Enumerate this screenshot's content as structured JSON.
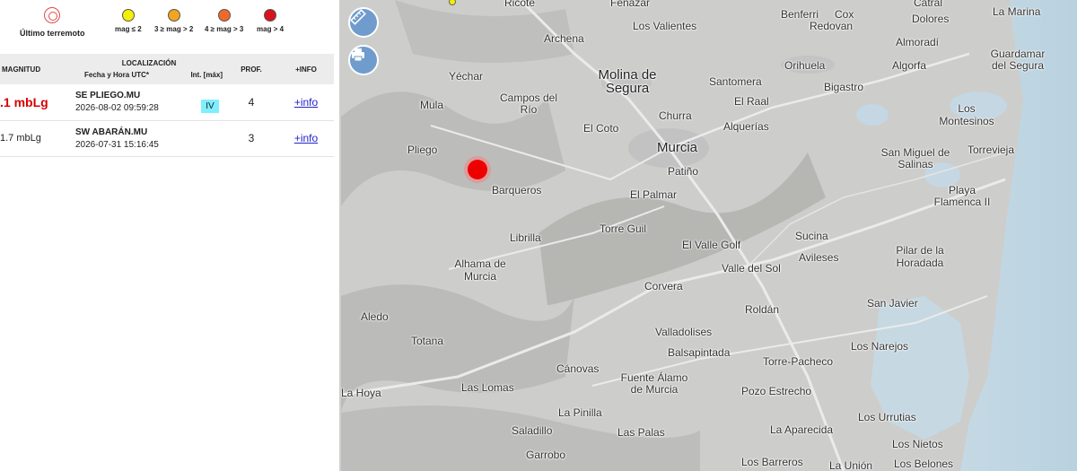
{
  "legend": {
    "last_quake_label": "Último terremoto",
    "items": [
      {
        "label": "mag ≤ 2",
        "color": "#f5f000"
      },
      {
        "label": "3 ≥ mag > 2",
        "color": "#f3a520"
      },
      {
        "label": "4 ≥ mag > 3",
        "color": "#ef6a2a"
      },
      {
        "label": "mag > 4",
        "color": "#d7141c"
      }
    ]
  },
  "table": {
    "headers": {
      "magnitude": "MAGNITUD",
      "location": "LOCALIZACIÓN",
      "datetime": "Fecha y Hora UTC*",
      "intensity": "Int. [máx]",
      "depth": "PROF.",
      "info": "+INFO"
    },
    "rows": [
      {
        "magnitude": ".1 mbLg",
        "place": "SE PLIEGO.MU",
        "datetime": "2026-08-02 09:59:28",
        "intensity": "IV",
        "depth": "4",
        "info": "+info"
      },
      {
        "magnitude": "1.7 mbLg",
        "place": "SW ABARÁN.MU",
        "datetime": "2026-07-31 15:16:45",
        "intensity": "",
        "depth": "3",
        "info": "+info"
      }
    ]
  },
  "map": {
    "tools": {
      "ruler_icon": "ruler-icon",
      "print_icon": "printer-icon"
    },
    "places": [
      "Ricote",
      "Fenazar",
      "Benferri",
      "Cox",
      "Catral",
      "La Marina",
      "Dolores",
      "Los Valientes",
      "Redovan",
      "Archena",
      "Almoradí",
      "Guardamar del Segura",
      "Yéchar",
      "Molina de Segura",
      "Orihuela",
      "Algorfa",
      "Santomera",
      "Bigastro",
      "Campos del Río",
      "Mula",
      "El Raal",
      "Los Montesinos",
      "Churra",
      "El Coto",
      "Alquerías",
      "Murcia",
      "San Miguel de Salinas",
      "Torrevieja",
      "Pliego",
      "Patiño",
      "Barqueros",
      "El Palmar",
      "Playa Flamenca II",
      "Torre Guil",
      "Sucina",
      "Librilla",
      "El Valle Golf",
      "Avileses",
      "Pilar de la Horadada",
      "Alhama de Murcia",
      "Valle del Sol",
      "Corvera",
      "San Javier",
      "Roldán",
      "Aledo",
      "Totana",
      "Valladolises",
      "Los Narejos",
      "Balsapintada",
      "Torre-Pacheco",
      "Cánovas",
      "Fuente Álamo de Murcia",
      "La Hoya",
      "Las Lomas",
      "Pozo Estrecho",
      "La Pinilla",
      "Los Urrutias",
      "Saladillo",
      "Las Palas",
      "La Aparecida",
      "Los Nietos",
      "Garrobo",
      "Los Barreros",
      "La Unión",
      "Los Belones"
    ]
  }
}
